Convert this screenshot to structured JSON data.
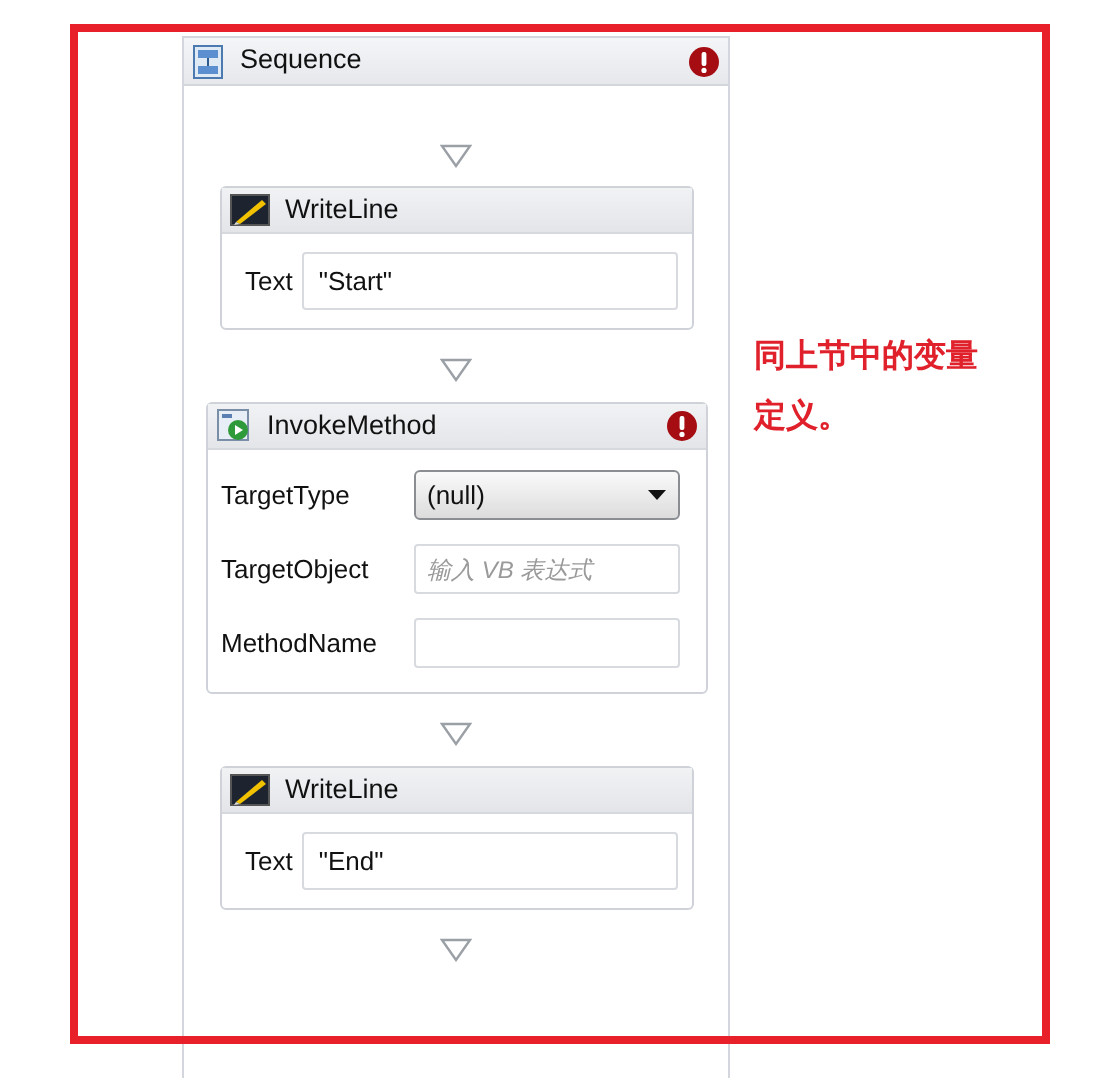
{
  "sequence": {
    "title": "Sequence",
    "error": true,
    "activities": [
      {
        "kind": "writeline",
        "title": "WriteLine",
        "error": false,
        "fields": [
          {
            "kind": "input",
            "label": "Text",
            "value": "\"Start\""
          }
        ]
      },
      {
        "kind": "invoke",
        "title": "InvokeMethod",
        "error": true,
        "fields": [
          {
            "kind": "select",
            "label": "TargetType",
            "value": "(null)"
          },
          {
            "kind": "input",
            "label": "TargetObject",
            "placeholder": "输入 VB 表达式"
          },
          {
            "kind": "input",
            "label": "MethodName"
          }
        ]
      },
      {
        "kind": "writeline",
        "title": "WriteLine",
        "error": false,
        "fields": [
          {
            "kind": "input",
            "label": "Text",
            "value": "\"End\""
          }
        ]
      }
    ]
  },
  "annotation": {
    "text": "同上节中的变量定义。"
  }
}
